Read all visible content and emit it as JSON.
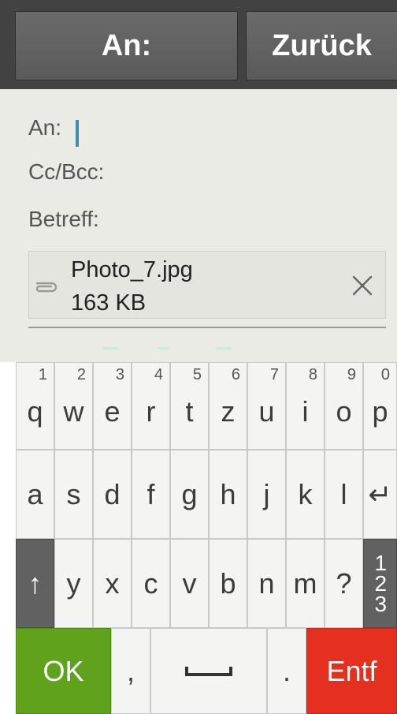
{
  "toolbar": {
    "to_button_label": "An:",
    "back_button_label": "Zurück"
  },
  "form": {
    "to_label": "An:",
    "ccbcc_label": "Cc/Bcc:",
    "subject_label": "Betreff:"
  },
  "attachment": {
    "filename": "Photo_7.jpg",
    "size": "163 KB"
  },
  "keyboard": {
    "row1": [
      {
        "char": "q",
        "num": "1"
      },
      {
        "char": "w",
        "num": "2"
      },
      {
        "char": "e",
        "num": "3"
      },
      {
        "char": "r",
        "num": "4"
      },
      {
        "char": "t",
        "num": "5"
      },
      {
        "char": "z",
        "num": "6"
      },
      {
        "char": "u",
        "num": "7"
      },
      {
        "char": "i",
        "num": "8"
      },
      {
        "char": "o",
        "num": "9"
      },
      {
        "char": "p",
        "num": "0"
      }
    ],
    "row2": [
      "a",
      "s",
      "d",
      "f",
      "g",
      "h",
      "j",
      "k",
      "l",
      "↵"
    ],
    "row3": [
      "↑",
      "y",
      "x",
      "c",
      "v",
      "b",
      "n",
      "m",
      "?",
      "1 2 3"
    ],
    "row4": {
      "ok_label": "OK",
      "comma": ",",
      "space": "⎵",
      "period": ".",
      "delete_label": "Entf"
    }
  },
  "colors": {
    "ok": "#5fa21b",
    "delete": "#e5301f",
    "cursor": "#3a8fb0",
    "topbar": "#424242"
  }
}
